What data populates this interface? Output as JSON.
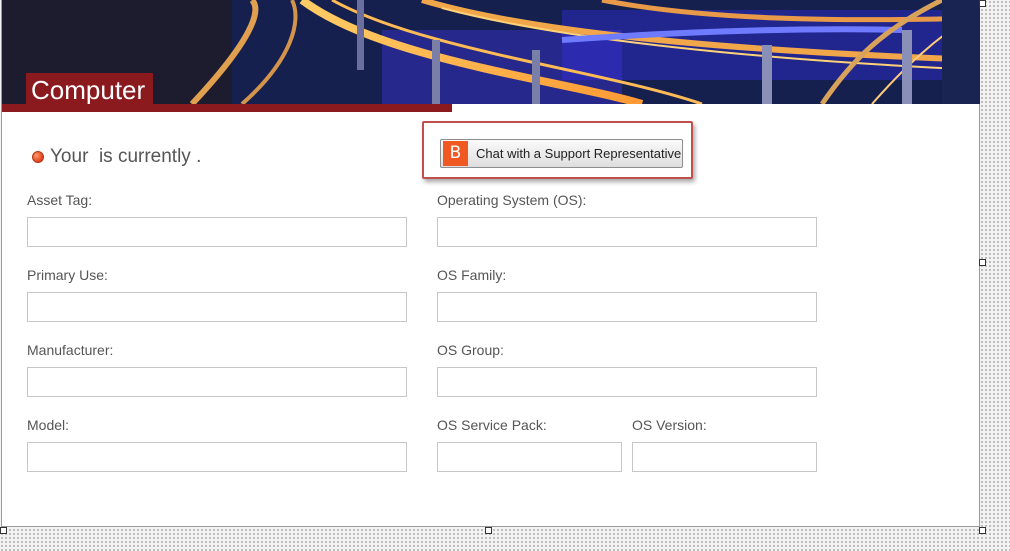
{
  "page": {
    "title": "Computer",
    "status_prefix": "Your ",
    "status_suffix": " is currently ."
  },
  "chat": {
    "icon_glyph": "B",
    "label": "Chat with a Support Representative",
    "brand_color": "#f05a22"
  },
  "colors": {
    "accent": "#8b1a1f",
    "highlight_border": "#c0504d",
    "status_dot": "#e0401b"
  },
  "fields": {
    "asset_tag": {
      "label": "Asset Tag:",
      "value": ""
    },
    "primary_use": {
      "label": "Primary Use:",
      "value": ""
    },
    "manufacturer": {
      "label": "Manufacturer:",
      "value": ""
    },
    "model": {
      "label": "Model:",
      "value": ""
    },
    "operating_system": {
      "label": "Operating System (OS):",
      "value": ""
    },
    "os_family": {
      "label": "OS Family:",
      "value": ""
    },
    "os_group": {
      "label": "OS Group:",
      "value": ""
    },
    "os_service_pack": {
      "label": "OS Service Pack:",
      "value": ""
    },
    "os_version": {
      "label": "OS Version:",
      "value": ""
    }
  }
}
